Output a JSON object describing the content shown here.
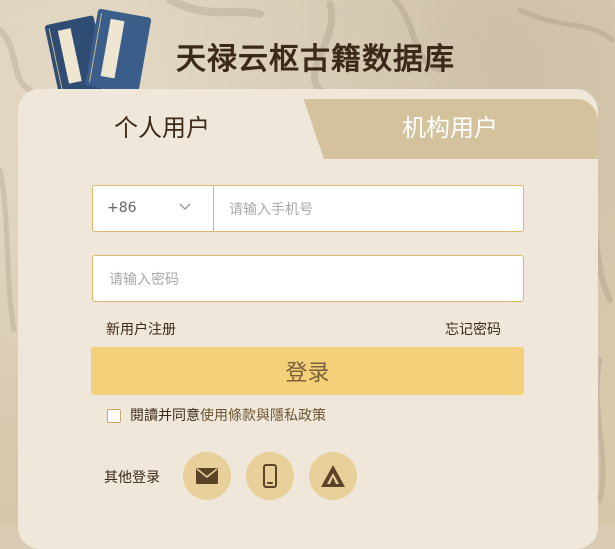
{
  "site": {
    "title": "天禄云枢古籍数据库"
  },
  "tabs": {
    "personal": "个人用户",
    "organization": "机构用户"
  },
  "login_form": {
    "country_code": "+86",
    "phone_placeholder": "请输入手机号",
    "password_placeholder": "请输入密码",
    "register_link": "新用户注册",
    "forgot_link": "忘记密码",
    "submit_label": "登录",
    "agree_prefix": "閱讀并同意",
    "terms_link": "使用條款與隱私政策"
  },
  "other_login": {
    "label": "其他登录",
    "methods": [
      "mail-icon",
      "mobile-icon",
      "institution-icon"
    ]
  },
  "colors": {
    "accent": "#f4d07b",
    "border": "#d9b96f",
    "inactive_tab": "#d3c29b",
    "text_dark": "#3b2a17",
    "social_bg": "#e8d09a"
  }
}
